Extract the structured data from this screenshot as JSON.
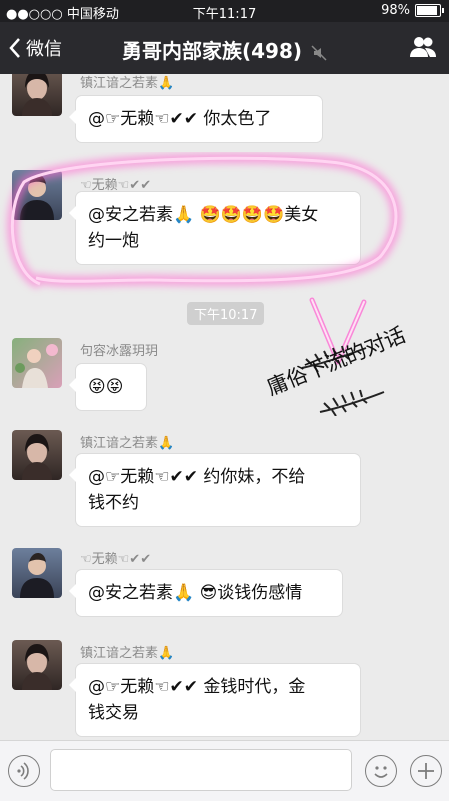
{
  "status_bar": {
    "carrier": "●●○○○ 中国移动",
    "time": "下午11:17",
    "battery": "98%"
  },
  "nav": {
    "back_label": "微信",
    "title": "勇哥内部家族(498)"
  },
  "messages": [
    {
      "sender": "镇江谙之若素🙏",
      "text": "@☞无赖☜✔✔ 你太色了"
    },
    {
      "sender": "☜无赖☜✔✔",
      "line1": "@安之若素🙏 🤩🤩🤩🤩美女",
      "line2": "约一炮"
    },
    {
      "sender": "句容冰露玥玥",
      "text": "😝😝"
    },
    {
      "sender": "镇江谙之若素🙏",
      "line1": "@☞无赖☜✔✔ 约你妹，不给",
      "line2": "钱不约"
    },
    {
      "sender": "☜无赖☜✔✔",
      "text": "@安之若素🙏 😎谈钱伤感情"
    },
    {
      "sender": "镇江谙之若素🙏",
      "line1": "@☞无赖☜✔✔ 金钱时代，金",
      "line2": "钱交易"
    }
  ],
  "timestamp": "下午10:17",
  "annotation_text": "庸俗下流的对话",
  "colors": {
    "nav_bg": "#2a2a2e",
    "chat_bg": "#ebebeb",
    "highlight": "#ff3fbf"
  }
}
